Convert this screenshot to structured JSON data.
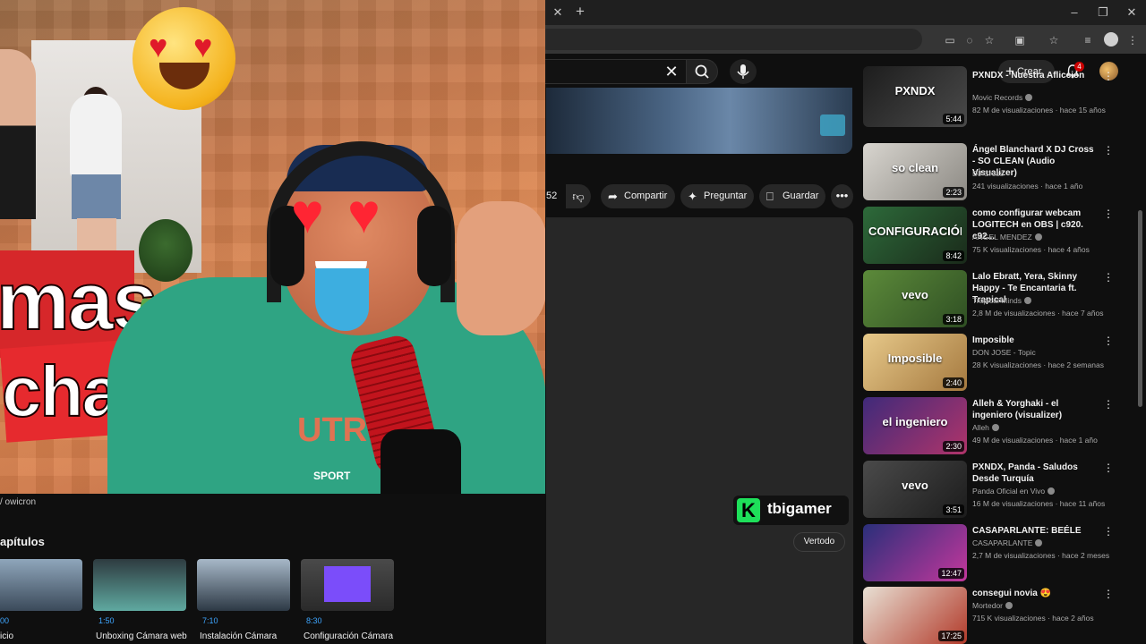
{
  "browser": {
    "tab_close": "✕",
    "tab_new": "+",
    "window_buttons": [
      "–",
      "❐",
      "✕"
    ]
  },
  "header": {
    "search_clear": "✕",
    "create_label": "Crear",
    "notification_count": "4"
  },
  "video": {
    "like_count_partial": "52",
    "actions": {
      "share": "Compartir",
      "ask": "Preguntar",
      "save": "Guardar"
    }
  },
  "overlay": {
    "text_line1": "mas",
    "text_line2": "chat",
    "shirt_text": "UTR",
    "shirt_sub": "SPORT"
  },
  "below_video": {
    "channel_handle": "/ owicron",
    "chapters_title": "apítulos",
    "chapters": [
      {
        "time": "00",
        "label": "icio"
      },
      {
        "time": "1:50",
        "label": "Unboxing Cámara web"
      },
      {
        "time": "7:10",
        "label": "Instalación Cámara"
      },
      {
        "time": "8:30",
        "label": "Configuración Cámara"
      }
    ]
  },
  "watermark": {
    "logo": "K",
    "text": "tbigamer"
  },
  "comments": {
    "sort_label": "Vertodo"
  },
  "sidebar": {
    "items": [
      {
        "title": "PXNDX - Nuestra Aflicción",
        "channel": "Movic Records",
        "meta": "82 M de visualizaciones · hace 15 años",
        "duration": "5:44",
        "thumb_text": "PXNDX",
        "colors": [
          "#1d1d1d",
          "#4a4a4a"
        ]
      },
      {
        "title": "Ángel Blanchard X DJ Cross - SO CLEAN (Audio Visualizer)",
        "channel": "DJ Cross",
        "meta": "241 visualizaciones · hace 1 año",
        "duration": "2:23",
        "thumb_text": "so clean",
        "colors": [
          "#d8d5cf",
          "#8c8983"
        ]
      },
      {
        "title": "como configurar webcam LOGITECH en OBS | c920. c92...",
        "channel": "ANGEL MENDEZ",
        "meta": "75 K visualizaciones · hace 4 años",
        "duration": "8:42",
        "thumb_text": "CONFIGURACIÓN REAL",
        "colors": [
          "#2d6a3a",
          "#1a2a1a"
        ]
      },
      {
        "title": "Lalo Ebratt, Yera, Skinny Happy - Te Encantaria ft. Trapical",
        "channel": "Trapical Minds",
        "meta": "2,8 M de visualizaciones · hace 7 años",
        "duration": "3:18",
        "thumb_text": "vevo",
        "colors": [
          "#5c8a3a",
          "#2f4f23"
        ]
      },
      {
        "title": "Imposible",
        "channel": "DON JOSE - Topic",
        "meta": "28 K visualizaciones · hace 2 semanas",
        "duration": "2:40",
        "thumb_text": "Imposible",
        "colors": [
          "#e7c98a",
          "#a5793f"
        ]
      },
      {
        "title": "Alleh & Yorghaki - el ingeniero (visualizer)",
        "channel": "Alleh",
        "meta": "49 M de visualizaciones · hace 1 año",
        "duration": "2:30",
        "thumb_text": "el ingeniero",
        "colors": [
          "#3f2a7a",
          "#b0346a"
        ]
      },
      {
        "title": "PXNDX, Panda - Saludos Desde Turquía",
        "channel": "Panda Oficial en Vivo",
        "meta": "16 M de visualizaciones · hace 11 años",
        "duration": "3:51",
        "thumb_text": "vevo",
        "colors": [
          "#4a4a4a",
          "#1c1c1c"
        ]
      },
      {
        "title": "CASAPARLANTE: BEÉLE",
        "channel": "CASAPARLANTE",
        "meta": "2,7 M de visualizaciones · hace 2 meses",
        "duration": "12:47",
        "thumb_text": "",
        "colors": [
          "#2a2f7a",
          "#c3379c"
        ]
      },
      {
        "title": "consegui novia 😍",
        "channel": "Mortedor",
        "meta": "715 K visualizaciones · hace 2 años",
        "duration": "17:25",
        "thumb_text": "",
        "colors": [
          "#e8e0d4",
          "#b23a2a"
        ]
      }
    ]
  }
}
